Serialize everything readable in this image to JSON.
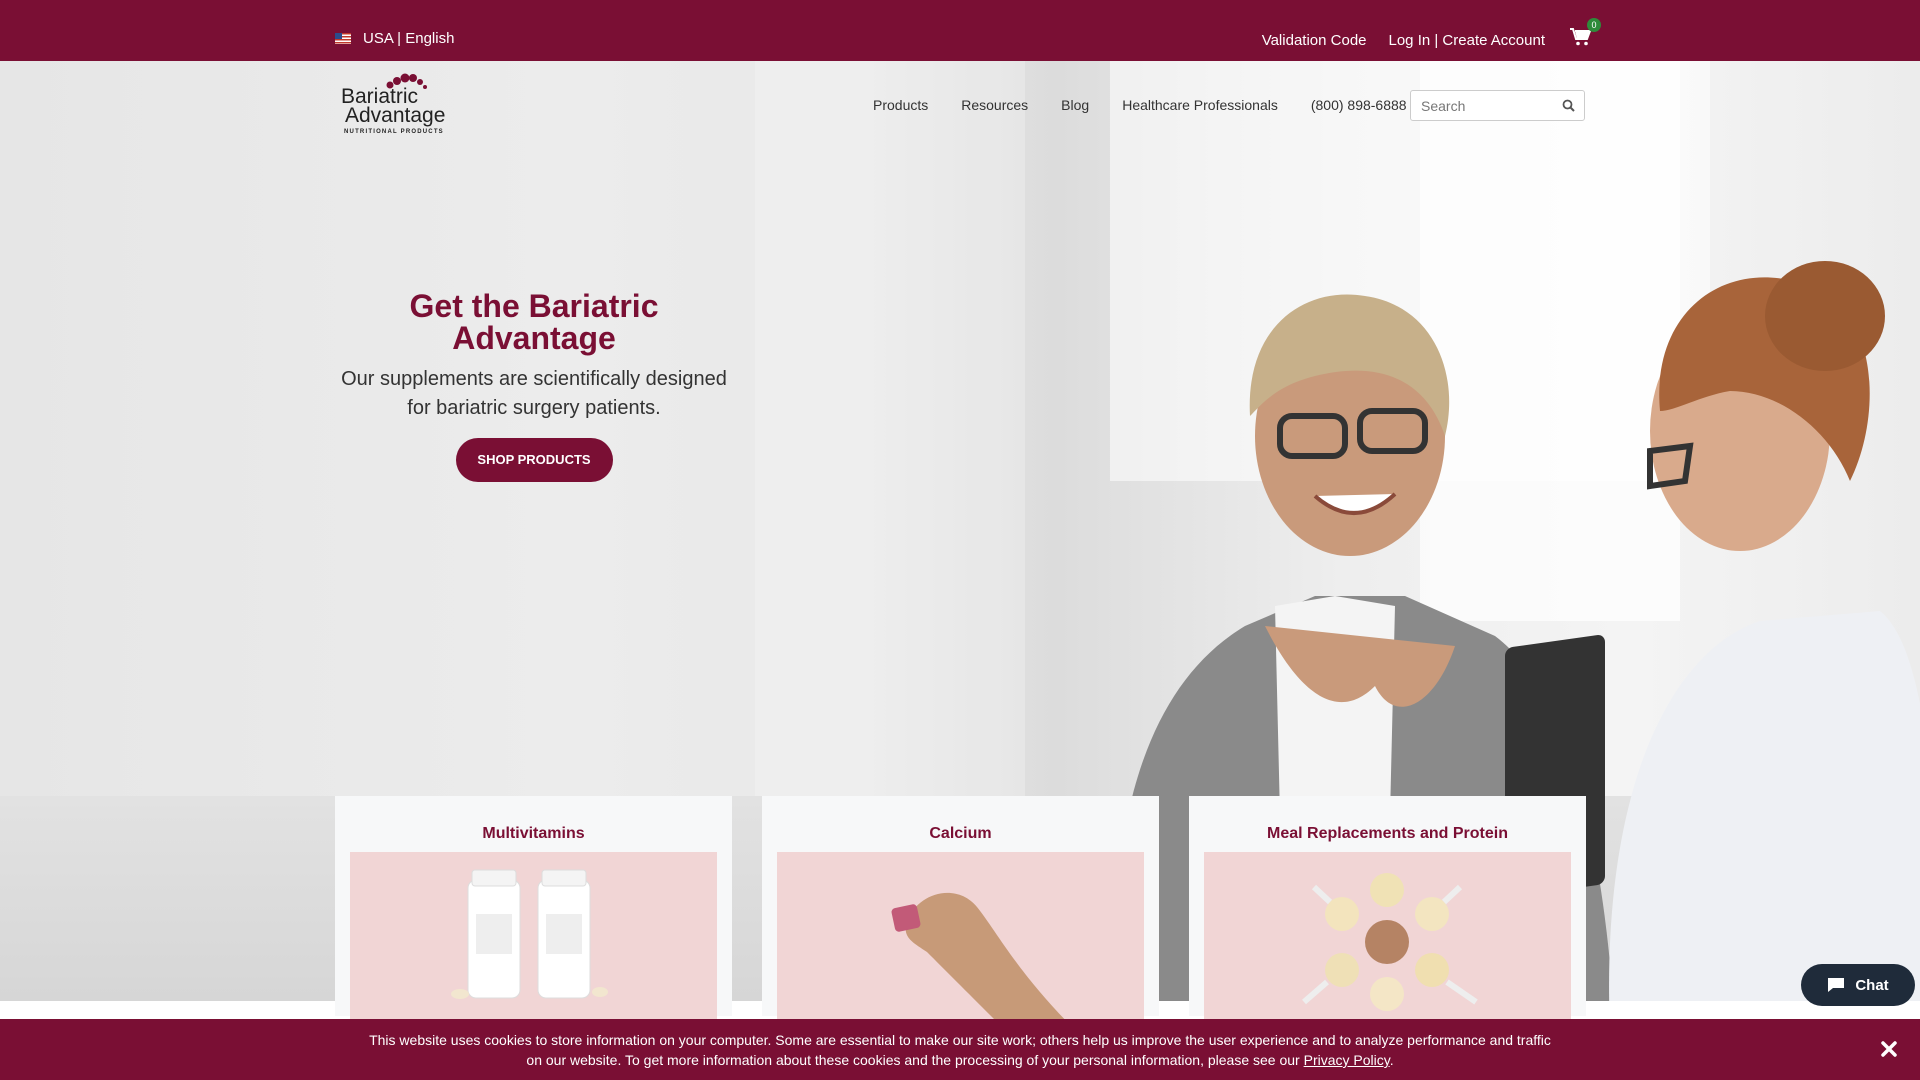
{
  "topbar": {
    "locale": "USA | English",
    "validation_code": "Validation Code",
    "login": "Log In | Create Account",
    "cart_count": "0"
  },
  "brand": {
    "logo_line1": "Bariatric",
    "logo_line2": "Advantage",
    "logo_tagline": "NUTRITIONAL PRODUCTS"
  },
  "nav": {
    "items": [
      {
        "label": "Products"
      },
      {
        "label": "Resources"
      },
      {
        "label": "Blog"
      },
      {
        "label": "Healthcare Professionals"
      },
      {
        "label": "(800) 898-6888"
      }
    ],
    "search_placeholder": "Search"
  },
  "hero": {
    "title": "Get the Bariatric Advantage",
    "subtitle": "Our supplements are scientifically designed for bariatric surgery patients.",
    "cta": "SHOP PRODUCTS"
  },
  "categories": [
    {
      "label": "Multivitamins",
      "icon": "vitamin-bottles"
    },
    {
      "label": "Calcium",
      "icon": "chewable-hand"
    },
    {
      "label": "Meal Replacements and Protein",
      "icon": "protein-scoops"
    }
  ],
  "cookie": {
    "text": "This website uses cookies to store information on your computer. Some are essential to make our site work; others help us improve the user experience and to analyze performance and traffic on our website. To get more information about these cookies and the processing of your personal information, please see our ",
    "link": "Privacy Policy",
    "end": "."
  },
  "chat": {
    "label": "Chat"
  },
  "colors": {
    "brand": "#7a0f34",
    "card_bg": "#f1d5d5",
    "chat_bg": "#1f2b3a"
  }
}
